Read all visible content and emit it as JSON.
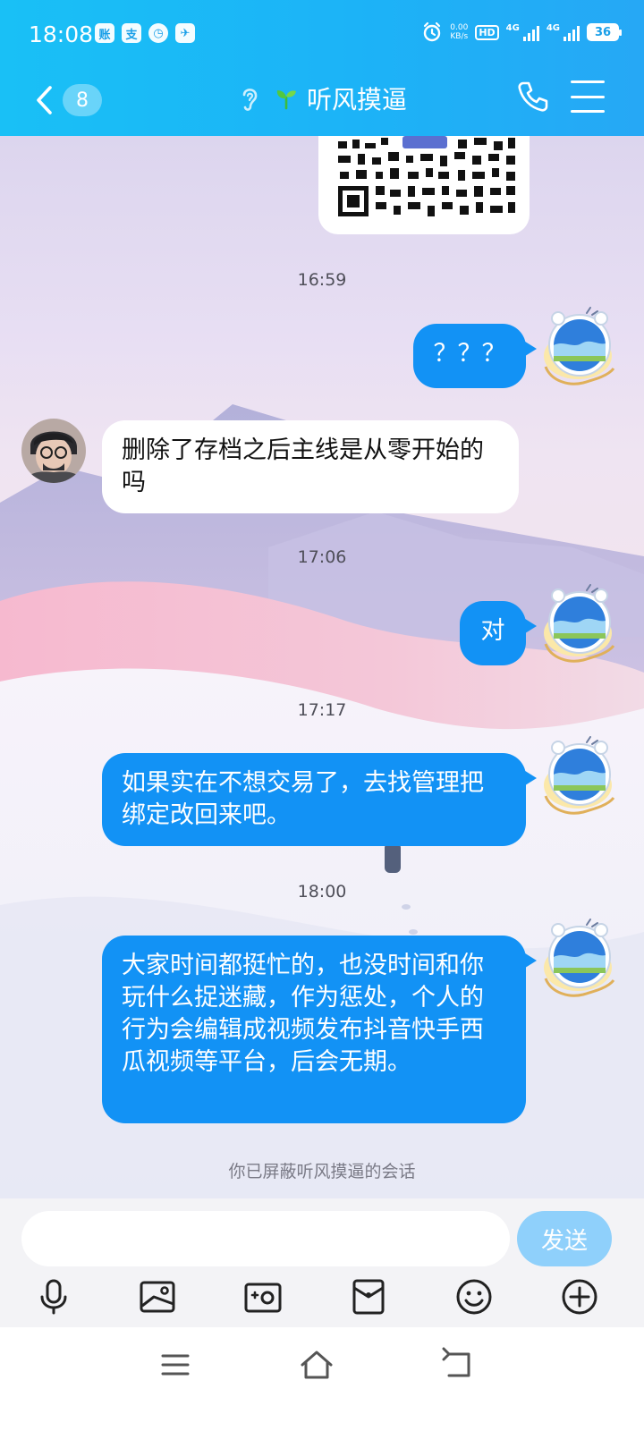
{
  "status_bar": {
    "time": "18:08",
    "apps": [
      "账",
      "支",
      "◷",
      "✈"
    ],
    "net_speed_value": "0.00",
    "net_speed_unit": "KB/s",
    "hd_label": "HD",
    "sim1_label": "4G",
    "sim2_label": "4G",
    "battery": "36"
  },
  "header": {
    "unread_count": "8",
    "title": "听风摸逼"
  },
  "messages": {
    "ts1": "16:59",
    "m1": "？？？",
    "m2": "删除了存档之后主线是从零开始的吗",
    "ts2": "17:06",
    "m3": "对",
    "ts3": "17:17",
    "m4": "如果实在不想交易了，去找管理把绑定改回来吧。",
    "ts4": "18:00",
    "m5": "大家时间都挺忙的，也没时间和你玩什么捉迷藏，作为惩处，个人的行为会编辑成视频发布抖音快手西瓜视频等平台，后会无期。"
  },
  "blocked_notice": "你已屏蔽听风摸逼的会话",
  "composer": {
    "value": "",
    "send_label": "发送"
  },
  "colors": {
    "header": "#1cb3f7",
    "outgoing_bubble": "#1292f5",
    "send_button": "#8fd0fb"
  },
  "icons": {
    "toolbar": [
      "microphone-icon",
      "image-icon",
      "camera-icon",
      "red-packet-icon",
      "emoji-icon",
      "plus-icon"
    ],
    "system_nav": [
      "menu-icon",
      "home-icon",
      "back-icon"
    ]
  }
}
